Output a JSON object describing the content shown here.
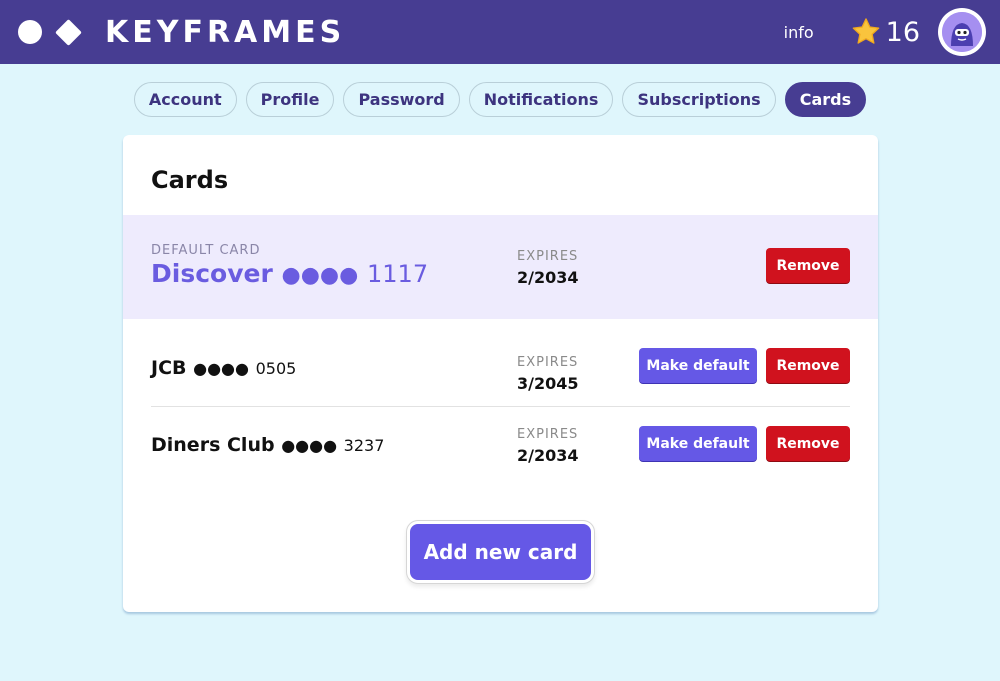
{
  "header": {
    "brand": "KEYFRAMES",
    "info_label": "info",
    "star_count": "16",
    "icons": [
      "logo-circle",
      "logo-diamond",
      "star-icon",
      "avatar"
    ]
  },
  "tabs": [
    {
      "label": "Account",
      "active": false
    },
    {
      "label": "Profile",
      "active": false
    },
    {
      "label": "Password",
      "active": false
    },
    {
      "label": "Notifications",
      "active": false
    },
    {
      "label": "Subscriptions",
      "active": false
    },
    {
      "label": "Cards",
      "active": true
    }
  ],
  "panel": {
    "title": "Cards",
    "default_label": "DEFAULT CARD",
    "expires_label": "EXPIRES",
    "cards": [
      {
        "brand": "Discover",
        "dots": "●●●●",
        "last4": "1117",
        "expires": "2/2034",
        "default": true
      },
      {
        "brand": "JCB",
        "dots": "●●●●",
        "last4": "0505",
        "expires": "3/2045",
        "default": false
      },
      {
        "brand": "Diners Club",
        "dots": "●●●●",
        "last4": "3237",
        "expires": "2/2034",
        "default": false
      }
    ],
    "remove_label": "Remove",
    "make_default_label": "Make default",
    "add_label": "Add new card"
  },
  "colors": {
    "header_bg": "#473d92",
    "page_bg": "#dff6fc",
    "accent": "#6558e6",
    "danger": "#d0121e",
    "default_row_bg": "#eeebfd"
  }
}
